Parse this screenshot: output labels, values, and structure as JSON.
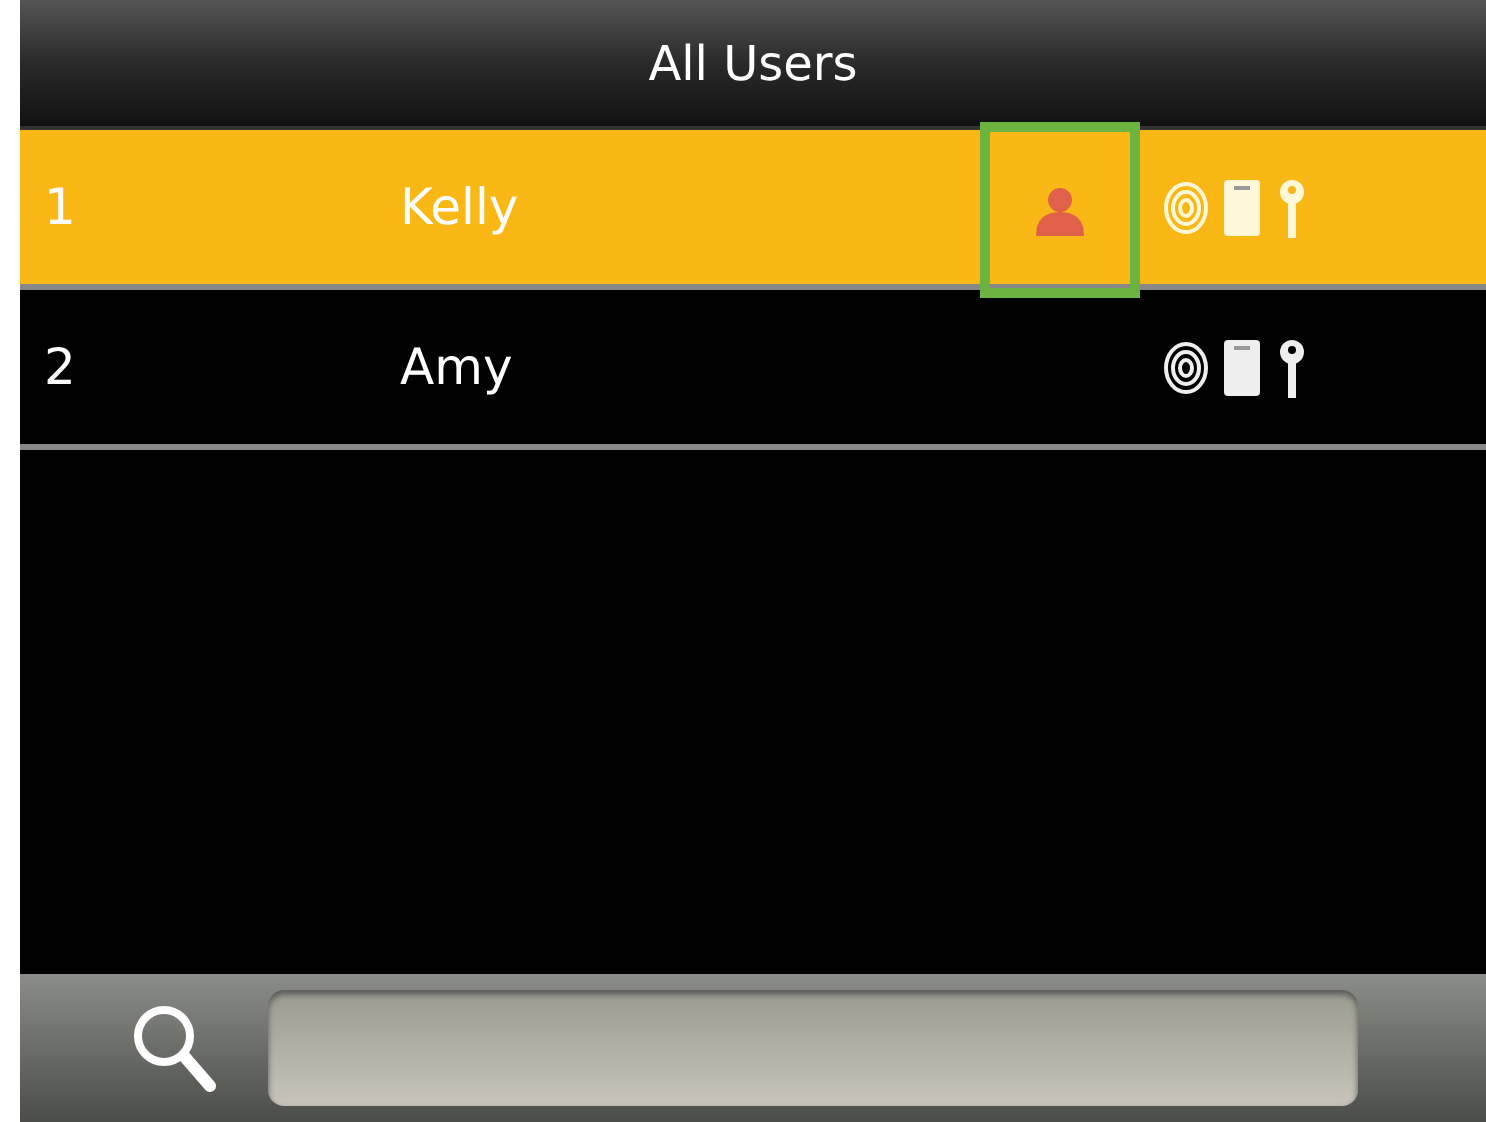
{
  "window": {
    "title": "All Users"
  },
  "users": [
    {
      "number": "1",
      "name": "Kelly",
      "selected": true,
      "photo": true,
      "highlighted": true,
      "fingerprint": true,
      "card": true,
      "password": true
    },
    {
      "number": "2",
      "name": "Amy",
      "selected": false,
      "photo": false,
      "highlighted": false,
      "fingerprint": true,
      "card": true,
      "password": true
    }
  ]
}
